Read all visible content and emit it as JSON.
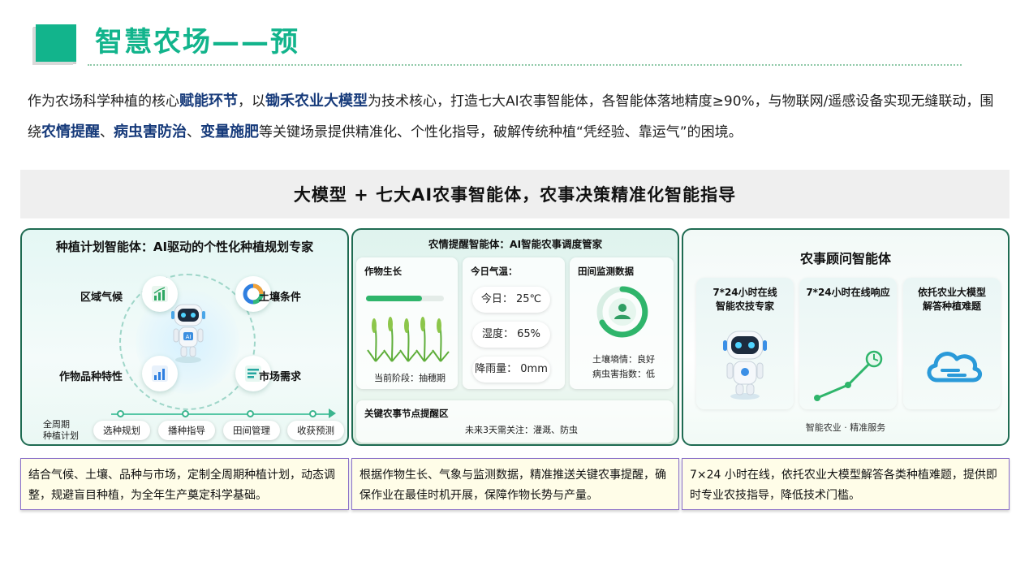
{
  "header": {
    "title": "智慧农场——预"
  },
  "intro": {
    "p1": "作为农场科学种植的核心",
    "b1": "赋能环节",
    "p2": "，以",
    "b2": "锄禾农业大模型",
    "p3": "为技术核心，打造七大AI农事智能体，各智能体落地精度≥90%，与物联网/遥感设备实现无缝联动，围绕",
    "b3": "农情提醒",
    "p4": "、",
    "b4": "病虫害防治",
    "p5": "、",
    "b5": "变量施肥",
    "p6": "等关键场景提供精准化、个性化指导，破解传统种植“凭经验、靠运气”的困境。"
  },
  "banner": {
    "text": "大模型 + 七大AI农事智能体，农事决策精准化智能指导"
  },
  "panel1": {
    "title": "种植计划智能体：AI驱动的个性化种植规划专家",
    "factors": [
      "区域气候",
      "土壤条件",
      "作物品种特性",
      "市场需求"
    ],
    "robot_badge": "AI",
    "timeline_label_line1": "全周期",
    "timeline_label_line2": "种植计划",
    "stages": [
      "选种规划",
      "播种指导",
      "田间管理",
      "收获预测"
    ]
  },
  "panel2": {
    "title": "农情提醒智能体：AI智能农事调度管家",
    "growth": {
      "title": "作物生长",
      "stage": "当前阶段：抽穗期",
      "progress": 0.72
    },
    "weather": {
      "title": "今日气温：",
      "today": "今日：  25℃",
      "humidity": "湿度：  65%",
      "rain": "降雨量：  0mm"
    },
    "monitor": {
      "title": "田间监测数据",
      "soil": "土壤墒情：良好",
      "pest": "病虫害指数：低"
    },
    "reminder": {
      "title": "关键农事节点提醒区",
      "text": "未来3天需关注：灌溉、防虫"
    }
  },
  "panel3": {
    "title": "农事顾问智能体",
    "cards": [
      {
        "line1": "7*24小时在线",
        "line2": "智能农技专家"
      },
      {
        "line1": "7*24小时在线响应",
        "line2": ""
      },
      {
        "line1": "依托农业大模型",
        "line2": "解答种植难题"
      }
    ],
    "footer": "智能农业 · 精准服务"
  },
  "descriptions": [
    "结合气候、土壤、品种与市场，定制全周期种植计划，动态调整，规避盲目种植，为全年生产奠定科学基础。",
    "根据作物生长、气象与监测数据，精准推送关键农事提醒，确保作业在最佳时机开展，保障作物长势与产量。",
    "7×24 小时在线，依托农业大模型解答各类种植难题，提供即时专业农技指导，降低技术门槛。"
  ],
  "colors": {
    "accent": "#12b48c",
    "keyword": "#163a7a",
    "panel_border": "#1f6b52",
    "desc_border": "#8a70c8",
    "desc_bg": "#fffde8"
  },
  "icons": [
    "bar-chart-icon",
    "donut-chart-icon",
    "list-chart-icon",
    "robot-icon",
    "wheat-icon",
    "farmer-icon",
    "line-trend-icon",
    "clock-icon",
    "cloud-icon"
  ]
}
